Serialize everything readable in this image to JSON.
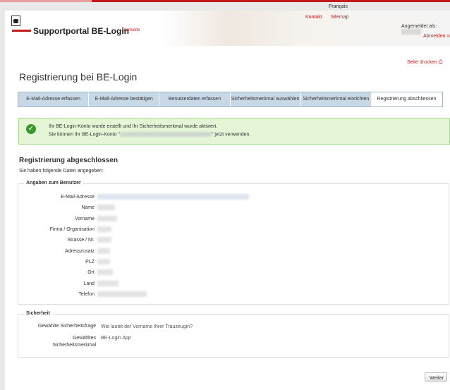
{
  "top": {
    "language": "Français"
  },
  "header": {
    "brand": "Supportportal BE-Login",
    "home_link": "Startseite",
    "links": [
      "Kontakt",
      "Sitemap"
    ],
    "logged_in": "Angemeldet als:",
    "logout": "Abmelden"
  },
  "page": {
    "print": "Seite drucken",
    "title": "Registrierung bei BE-Login"
  },
  "steps": [
    {
      "label": "E-Mail-Adresse erfassen",
      "current": false
    },
    {
      "label": "E-Mail-Adresse bestätigen",
      "current": false
    },
    {
      "label": "Benutzerdaten erfassen",
      "current": false
    },
    {
      "label": "Sicherheitsmerkmal auswählen",
      "current": false
    },
    {
      "label": "Sicherheitsmerkmal einrichten",
      "current": false
    },
    {
      "label": "Registrierung abschliessen",
      "current": true
    }
  ],
  "message": {
    "line1": "Ihr BE-Login-Konto wurde erstellt und Ihr Sicherheitsmerkmal wurde aktiviert.",
    "line2_prefix": "Sie können Ihr BE-Login-Konto \"",
    "line2_suffix": "\" jetzt verwenden."
  },
  "summary": {
    "heading": "Registrierung abgeschlossen",
    "intro": "Sie haben folgende Daten angegeben:"
  },
  "user_section": {
    "legend": "Angaben zum Benutzer",
    "fields": [
      "E-Mail-Adresse",
      "Name",
      "Vorname",
      "Firma / Organisation",
      "Strasse / Nr.",
      "Adresszusatz",
      "PLZ",
      "Ort",
      "Land",
      "Telefon"
    ]
  },
  "security_section": {
    "legend": "Sicherheit",
    "question_label": "Gewählte Sicherheitsfrage",
    "question_value": "Wie lautet der Vorname Ihrer Trauzeugin?",
    "feature_label_1": "Gewähltes",
    "feature_label_2": "Sicherheitsmerkmal",
    "feature_value": "BE-Login App"
  },
  "actions": {
    "next": "Weiter"
  },
  "colors": {
    "accent": "#c41a1a",
    "step_bg": "#c8d8e6",
    "success_bg": "#e4f6d6",
    "success_icon": "#3a9a2e"
  }
}
